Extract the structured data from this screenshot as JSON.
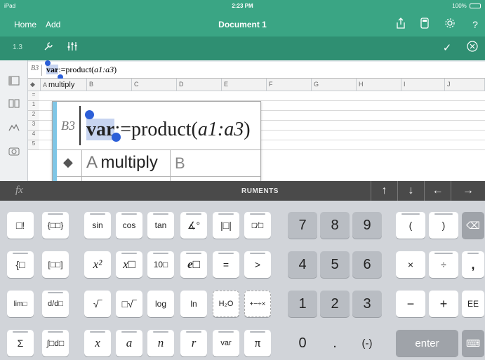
{
  "status_bar": {
    "device": "iPad",
    "time": "2:23 PM",
    "battery": "100%"
  },
  "nav": {
    "home": "Home",
    "add": "Add",
    "document_title": "Document 1"
  },
  "toolbar": {
    "page_number": "1.3"
  },
  "entry_line": {
    "cell_ref": "B3",
    "var_name": "var",
    "rest": ":=product(",
    "arg": "a1:a3",
    "close": ")"
  },
  "grid": {
    "columns": [
      "A",
      "B",
      "C",
      "D",
      "E",
      "F",
      "G",
      "H",
      "I",
      "J"
    ],
    "col_a_label": "multiply",
    "rows": [
      "1",
      "2",
      "3",
      "4",
      "5"
    ],
    "formula_row_symbol": "="
  },
  "magnifier": {
    "cell_ref": "B3",
    "var_name": "var",
    "rest": ":=product(",
    "arg": "a1:a3",
    "close": ")",
    "col_a": "A",
    "col_a_label": "multiply",
    "col_b": "B",
    "formula_symbol": "="
  },
  "keyboard_header": {
    "fx": "fx",
    "args_text": "RUMENTS"
  },
  "keys": {
    "factorial": "□!",
    "matrix_tmpl": "{□□}",
    "sin": "sin",
    "cos": "cos",
    "tan": "tan",
    "angle": "∡°",
    "abs": "|□|",
    "frac": "□⁄□",
    "n7": "7",
    "n8": "8",
    "n9": "9",
    "lparen": "(",
    "rparen": ")",
    "backspace": "⌫",
    "piecewise": "{□",
    "matrix": "[□□]",
    "x_squared": "x²",
    "x_power": "x□",
    "ten_power": "10□",
    "e_power": "e□",
    "equals": "=",
    "greater": ">",
    "n4": "4",
    "n5": "5",
    "n6": "6",
    "times": "×",
    "divide": "÷",
    "comma": ",",
    "limit": "lim□",
    "deriv": "d/d□",
    "sqrt": "√‾",
    "nroot": "□√‾",
    "log": "log",
    "ln": "ln",
    "h2o": "H₂O",
    "plusminus": "+−÷×",
    "n1": "1",
    "n2": "2",
    "n3": "3",
    "minus": "−",
    "plus": "+",
    "ee": "EE",
    "sum": "Σ",
    "integral": "∫□d□",
    "x": "x",
    "a": "a",
    "n": "n",
    "r": "r",
    "var": "var",
    "pi": "π",
    "n0": "0",
    "dot": ".",
    "neg": "(-)",
    "enter": "enter",
    "hide_keyboard": "⌨"
  },
  "colors": {
    "header": "#3aa584",
    "toolbar": "#2f8f72",
    "keyboard_bg": "#d1d4d9",
    "kb_header": "#4a4a4a",
    "selection": "#c7d4f0",
    "handle": "#2c5fd8",
    "stripe": "#7fc6e6"
  }
}
